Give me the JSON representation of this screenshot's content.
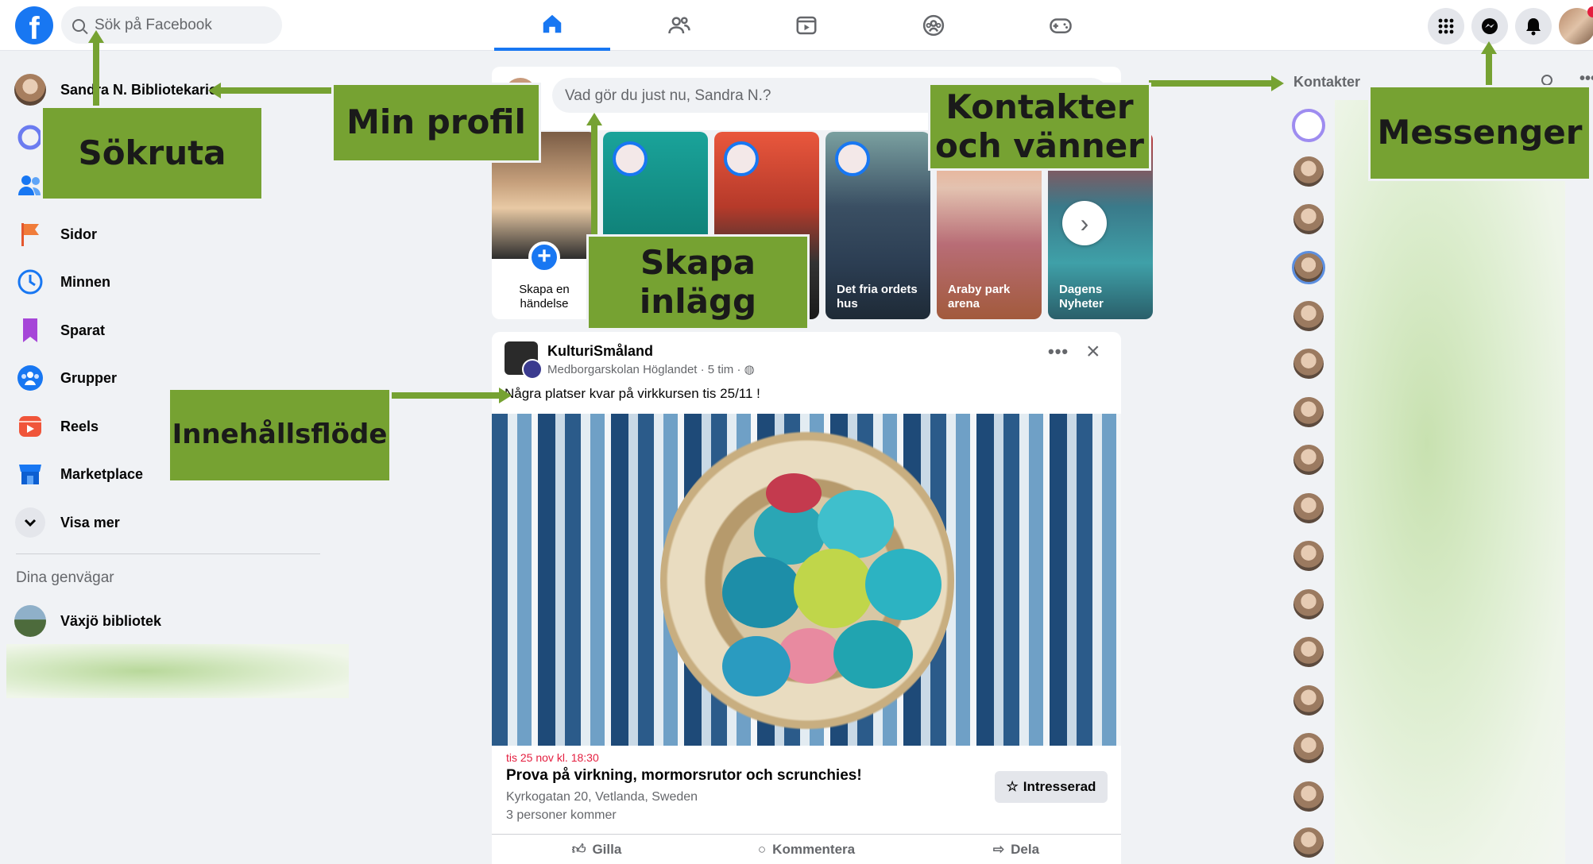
{
  "search": {
    "placeholder": "Sök på Facebook"
  },
  "profile": {
    "name": "Sandra N. Bibliotekarie"
  },
  "sidebar": {
    "items": [
      {
        "label": "Sidor"
      },
      {
        "label": "Minnen"
      },
      {
        "label": "Sparat"
      },
      {
        "label": "Grupper"
      },
      {
        "label": "Reels"
      },
      {
        "label": "Marketplace"
      },
      {
        "label": "Visa mer"
      }
    ],
    "shortcuts_title": "Dina genvägar",
    "shortcuts": [
      {
        "label": "Växjö bibliotek"
      }
    ]
  },
  "composer": {
    "placeholder": "Vad gör du just nu, Sandra N.?"
  },
  "stories": [
    {
      "label": "Skapa en händelse"
    },
    {
      "label": "Det fria ordets hus"
    },
    {
      "label": "Araby park arena"
    },
    {
      "label": "Dagens Nyheter"
    }
  ],
  "post": {
    "author": "KulturiSmåland",
    "meta": "Medborgarskolan Höglandet · 5 tim ·",
    "text": "Några platser kvar på virkkursen tis 25/11 !",
    "event_date": "tis 25 nov kl. 18:30",
    "event_title": "Prova på virkning, mormorsrutor och scrunchies!",
    "event_address": "Kyrkogatan 20, Vetlanda, Sweden",
    "event_going": "3 personer kommer",
    "interested_label": "Intresserad",
    "actions": {
      "like": "Gilla",
      "comment": "Kommentera",
      "share": "Dela"
    }
  },
  "contacts": {
    "title": "Kontakter"
  },
  "callouts": {
    "search": "Sökruta",
    "profile": "Min profil",
    "create_post_line1": "Skapa",
    "create_post_line2": "inlägg",
    "contacts_line1": "Kontakter",
    "contacts_line2": "och vänner",
    "messenger": "Messenger",
    "feed": "Innehållsflöde"
  },
  "colors": {
    "brand": "#1877f2",
    "callout": "#76a232",
    "event_date": "#e41e3f"
  }
}
